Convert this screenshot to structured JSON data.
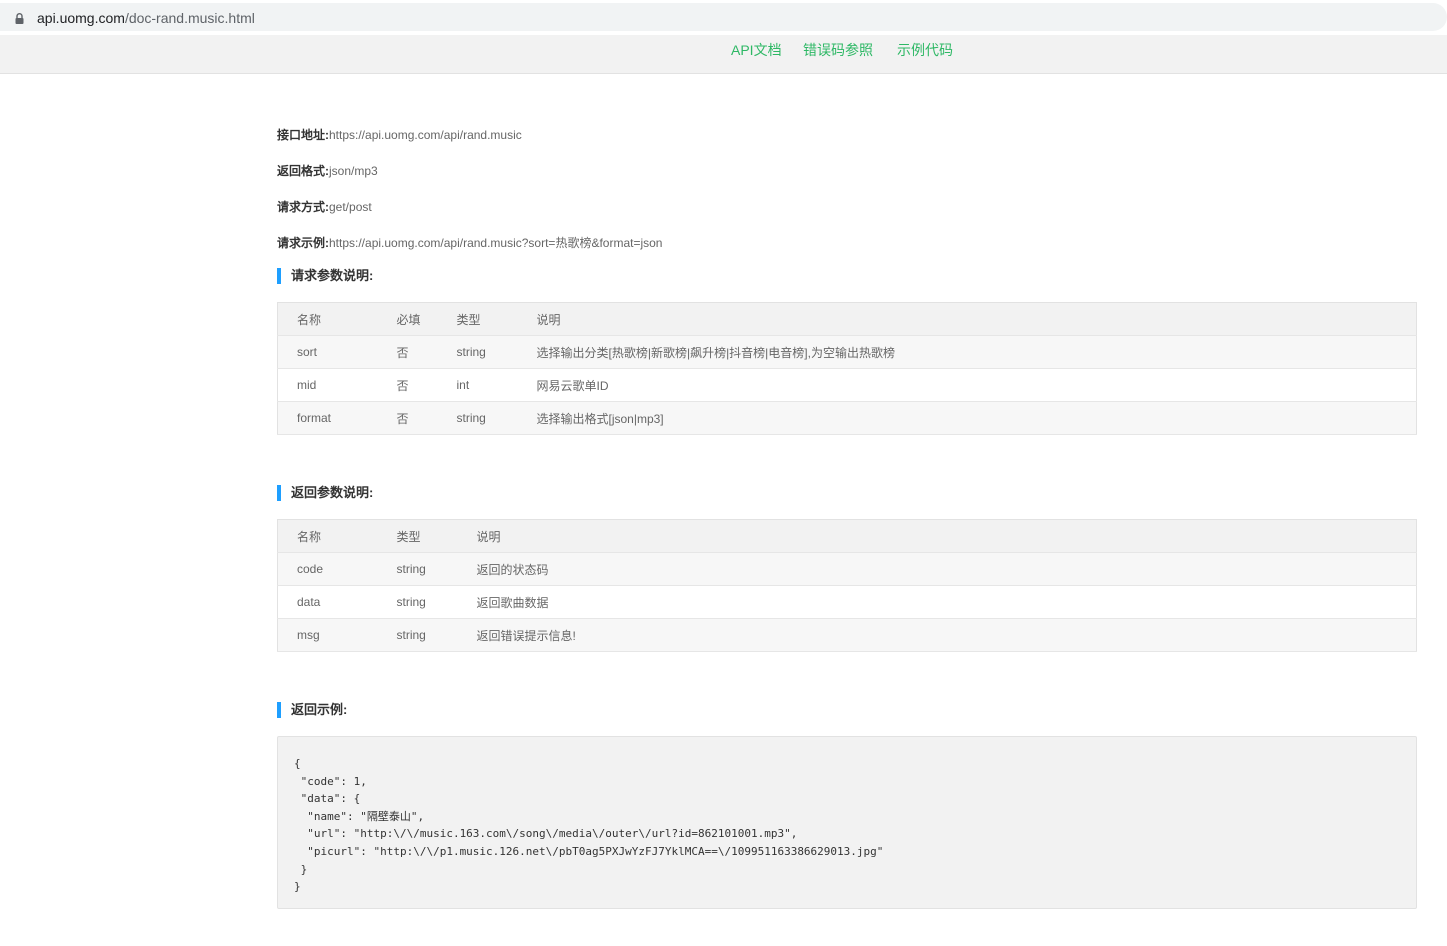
{
  "browser": {
    "url_host": "api.uomg.com",
    "url_path": "/doc-rand.music.html"
  },
  "nav": {
    "items": [
      "API文档",
      "错误码参照",
      "示例代码"
    ]
  },
  "info": [
    {
      "key": "接口地址:",
      "value": "https://api.uomg.com/api/rand.music"
    },
    {
      "key": "返回格式:",
      "value": "json/mp3"
    },
    {
      "key": "请求方式:",
      "value": "get/post"
    },
    {
      "key": "请求示例:",
      "value": "https://api.uomg.com/api/rand.music?sort=热歌榜&format=json"
    }
  ],
  "request_params": {
    "heading": "请求参数说明:",
    "headers": [
      "名称",
      "必填",
      "类型",
      "说明"
    ],
    "rows": [
      [
        "sort",
        "否",
        "string",
        "选择输出分类[热歌榜|新歌榜|飙升榜|抖音榜|电音榜],为空输出热歌榜"
      ],
      [
        "mid",
        "否",
        "int",
        "网易云歌单ID"
      ],
      [
        "format",
        "否",
        "string",
        "选择输出格式[json|mp3]"
      ]
    ]
  },
  "response_params": {
    "heading": "返回参数说明:",
    "headers": [
      "名称",
      "类型",
      "说明"
    ],
    "rows": [
      [
        "code",
        "string",
        "返回的状态码"
      ],
      [
        "data",
        "string",
        "返回歌曲数据"
      ],
      [
        "msg",
        "string",
        "返回错误提示信息!"
      ]
    ]
  },
  "example": {
    "heading": "返回示例:",
    "code": "{\n \"code\": 1,\n \"data\": {\n  \"name\": \"隔壁泰山\",\n  \"url\": \"http:\\/\\/music.163.com\\/song\\/media\\/outer\\/url?id=862101001.mp3\",\n  \"picurl\": \"http:\\/\\/p1.music.126.net\\/pbT0ag5PXJwYzFJ7YklMCA==\\/109951163386629013.jpg\"\n }\n}"
  }
}
